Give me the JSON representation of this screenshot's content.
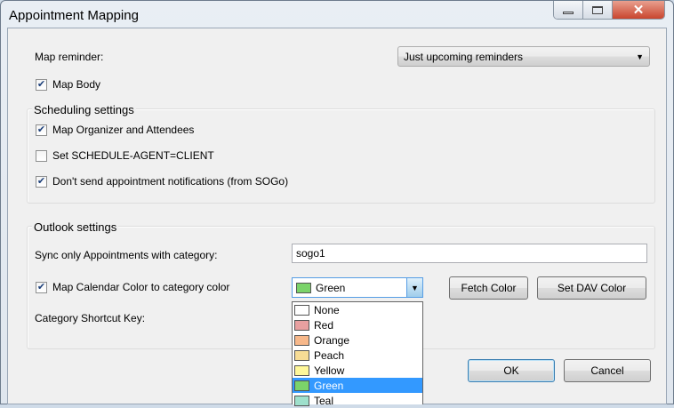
{
  "window": {
    "title": "Appointment Mapping"
  },
  "map_reminder": {
    "label": "Map reminder:",
    "value": "Just upcoming reminders"
  },
  "map_body": {
    "label": "Map Body",
    "checked": true
  },
  "scheduling": {
    "title": "Scheduling settings",
    "items": [
      {
        "label": "Map Organizer and Attendees",
        "checked": true
      },
      {
        "label": "Set SCHEDULE-AGENT=CLIENT",
        "checked": false
      },
      {
        "label": "Don't send appointment notifications (from SOGo)",
        "checked": true
      }
    ]
  },
  "outlook": {
    "title": "Outlook settings",
    "category_label": "Sync only Appointments with category:",
    "category_value": "sogo1",
    "map_color": {
      "label": "Map Calendar Color to category color",
      "checked": true
    },
    "color_select": {
      "value": "Green",
      "swatch": "#7bd36a"
    },
    "fetch_color": "Fetch Color",
    "set_dav_color": "Set DAV Color",
    "shortcut_label": "Category Shortcut Key:"
  },
  "dropdown_options": [
    {
      "label": "None",
      "color": "#ffffff"
    },
    {
      "label": "Red",
      "color": "#e8a0a0"
    },
    {
      "label": "Orange",
      "color": "#f7b88a"
    },
    {
      "label": "Peach",
      "color": "#f7dc95"
    },
    {
      "label": "Yellow",
      "color": "#fff799"
    },
    {
      "label": "Green",
      "color": "#7bd36a",
      "selected": true
    },
    {
      "label": "Teal",
      "color": "#9ee0cc"
    }
  ],
  "buttons": {
    "ok": "OK",
    "cancel": "Cancel"
  }
}
